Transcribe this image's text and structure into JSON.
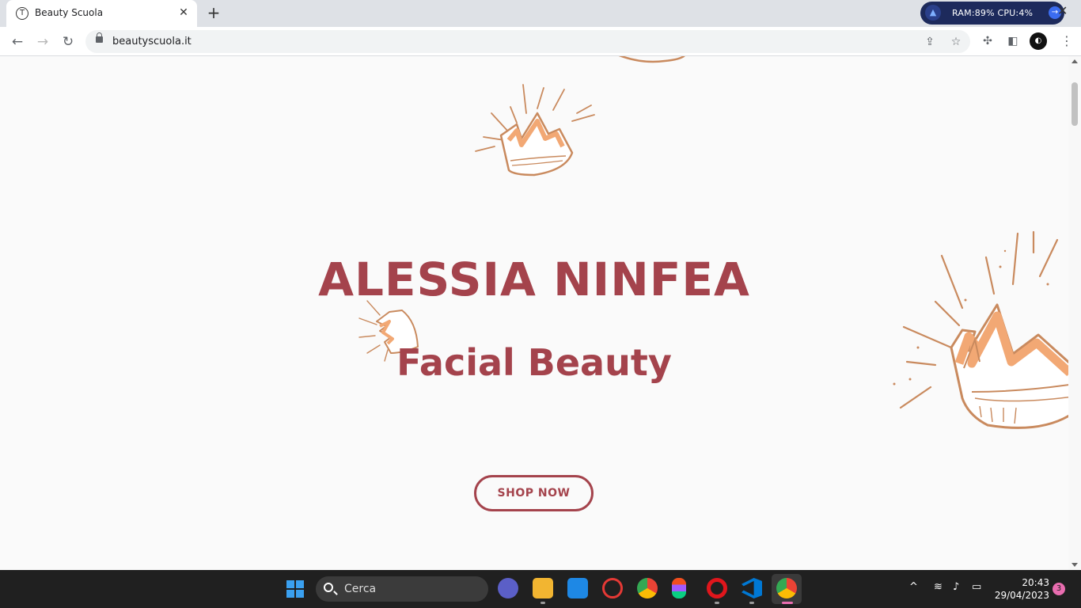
{
  "browser": {
    "tab_title": "Beauty Scuola",
    "tab_favicon": "T",
    "url": "beautyscuola.it",
    "sysmon": "RAM:89%  CPU:4%"
  },
  "hero": {
    "title": "ALESSIA NINFEA",
    "subtitle": "Facial Beauty",
    "cta": "SHOP NOW"
  },
  "colors": {
    "brand": "#a4434c",
    "crown_orange": "#f2a874",
    "crown_stroke": "#c98a5e"
  },
  "taskbar": {
    "search_placeholder": "Cerca",
    "time": "20:43",
    "date": "29/04/2023",
    "notifications": "3",
    "apps": [
      "video-call-icon",
      "file-explorer-icon",
      "mail-icon",
      "antivirus-icon",
      "chrome-icon",
      "figma-icon",
      "opera-icon",
      "vscode-icon",
      "chrome-profile-icon"
    ]
  }
}
